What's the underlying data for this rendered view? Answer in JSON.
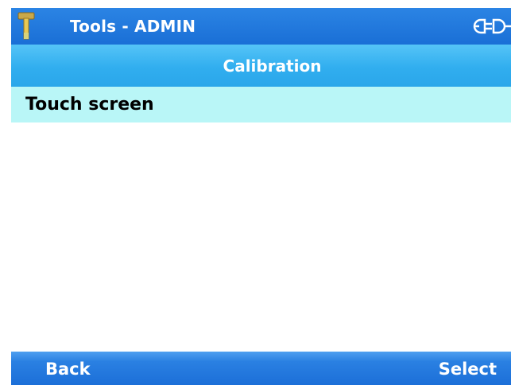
{
  "window": {
    "title": "Tools - ADMIN",
    "app_icon": "hammer-icon",
    "status_icon": "connector-icon"
  },
  "header": {
    "title": "Calibration"
  },
  "list": {
    "items": [
      {
        "label": "Touch screen",
        "selected": true
      }
    ]
  },
  "softkeys": {
    "left_label": "Back",
    "right_label": "Select"
  },
  "colors": {
    "title_bar": "#1a6fd6",
    "sub_header": "#31aeef",
    "selection": "#b9f6f7",
    "softkey_bar": "#2a80e2"
  }
}
